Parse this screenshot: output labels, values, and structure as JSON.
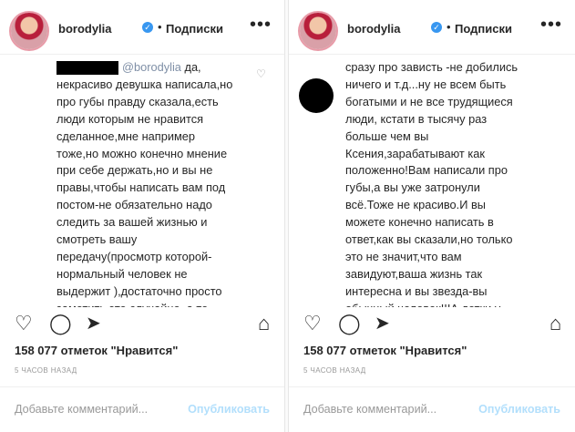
{
  "left": {
    "username": "borodylia",
    "verified": "✓",
    "follow_label": "Подписки",
    "mention": "@borodylia",
    "comment": " да,\nнекрасиво девушка написала,но\nпро губы правду сказала,есть\nлюди которым не нравится\nсделанное,мне например\nтоже,но можно конечно мнение\nпри себе держать,но и вы не\nправы,чтобы написать вам под\nпостом-не обязательно надо\nследить за вашей жизнью и\nсмотреть вашу\nпередачу(просмотр которой-\nнормальный человек не\nвыдержит ),достаточно просто\nзаметить это случайно ,а то\nсразу про зависть -не добились",
    "likes": "158 077 отметок \"Нравится\"",
    "time": "5 часов назад",
    "comment_placeholder": "Добавьте комментарий...",
    "publish_label": "Опубликовать"
  },
  "right": {
    "username": "borodylia",
    "verified": "✓",
    "follow_label": "Подписки",
    "comment": "сразу про зависть -не добились\nничего и т.д...ну не всем быть\nбогатыми и не все трудящиеся\nлюди, кстати в тысячу раз\nбольше чем вы\nКсения,зарабатывают как\nположенно!Вам написали про\nгубы,а вы уже затронули\nвсё.Тоже не красиво.И вы\nможете конечно написать в\nответ,как вы сказали,но только\nэто не значит,что вам\nзавидуют,ваша жизнь так\nинтересна и вы звезда-вы\nобычный человек!!!А детки у",
    "likes": "158 077 отметок \"Нравится\"",
    "time": "5 часов назад",
    "comment_placeholder": "Добавьте комментарий...",
    "publish_label": "Опубликовать"
  },
  "icons": {
    "more": "more-icon",
    "like": "heart-icon",
    "comment": "comment-icon",
    "share": "share-icon",
    "save": "bookmark-icon",
    "comment_like": "small-heart-icon"
  },
  "colors": {
    "text": "#262626",
    "muted": "#999999",
    "verified": "#3897f0",
    "publish_disabled": "#b2dffc"
  }
}
